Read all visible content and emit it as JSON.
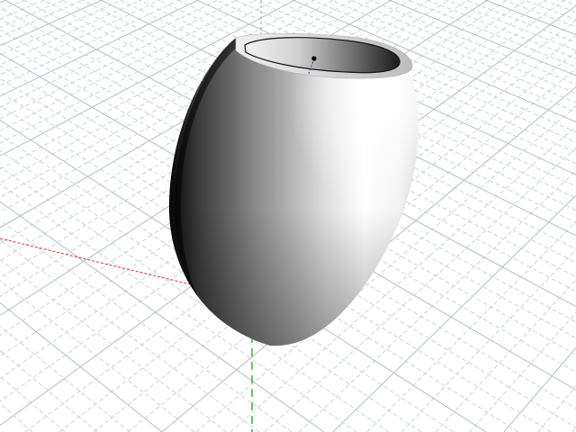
{
  "viewport": {
    "view": "perspective",
    "background_color": "#ffffff",
    "grid_visible": true,
    "grid_line_color": "#c9d2dc",
    "grid_major_line_color": "#b3bdc8",
    "axes": {
      "x_axis_color": "#e03030",
      "y_axis_color": "#20a020",
      "z_axis_color": "#3030c0"
    },
    "object": {
      "type": "vase",
      "shading": "smooth",
      "base_color": "#ffffff",
      "shadow_color": "#000000",
      "selected": false
    }
  }
}
